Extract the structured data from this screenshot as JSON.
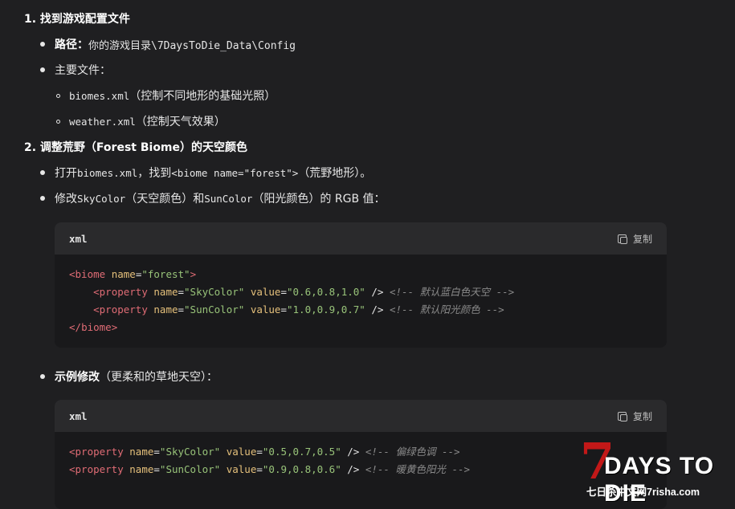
{
  "sec1": {
    "title": "1. 找到游戏配置文件"
  },
  "path": {
    "label": "路径：",
    "value": "你的游戏目录\\7DaysToDie_Data\\Config"
  },
  "main_files": {
    "label": "主要文件："
  },
  "file1": {
    "name": "biomes.xml",
    "desc": "（控制不同地形的基础光照）"
  },
  "file2": {
    "name": "weather.xml",
    "desc": "（控制天气效果）"
  },
  "sec2": {
    "title": "2. 调整荒野（Forest Biome）的天空颜色"
  },
  "step1": {
    "a": "打开 ",
    "file": "biomes.xml",
    "b": "，找到 ",
    "code": "<biome name=\"forest\">",
    "c": "（荒野地形）。"
  },
  "step2": {
    "a": "修改 ",
    "code1": "SkyColor",
    "b": "（天空颜色）和 ",
    "code2": "SunColor",
    "c": "（阳光颜色）的 RGB 值："
  },
  "code1": {
    "lang": "xml",
    "copy": "复制",
    "l1": {
      "open": "<",
      "tag": "biome",
      "sp": " ",
      "attr": "name",
      "eq": "=",
      "val": "\"forest\"",
      "close": ">"
    },
    "l2": {
      "ind": "    ",
      "open": "<",
      "tag": "property",
      "a1": "name",
      "v1": "\"SkyColor\"",
      "a2": "value",
      "v2": "\"0.6,0.8,1.0\"",
      "end": " />",
      "com": "<!-- 默认蓝白色天空 -->"
    },
    "l3": {
      "ind": "    ",
      "open": "<",
      "tag": "property",
      "a1": "name",
      "v1": "\"SunColor\"",
      "a2": "value",
      "v2": "\"1.0,0.9,0.7\"",
      "end": " />",
      "com": "<!-- 默认阳光颜色 -->"
    },
    "l4": {
      "open": "</",
      "tag": "biome",
      "close": ">"
    }
  },
  "example": {
    "label": "示例修改",
    "rest": "（更柔和的草地天空）："
  },
  "code2": {
    "lang": "xml",
    "copy": "复制",
    "l1": {
      "open": "<",
      "tag": "property",
      "a1": "name",
      "v1": "\"SkyColor\"",
      "a2": "value",
      "v2": "\"0.5,0.7,0.5\"",
      "end": " />",
      "com": "<!-- 偏绿色调 -->"
    },
    "l2": {
      "open": "<",
      "tag": "property",
      "a1": "name",
      "v1": "\"SunColor\"",
      "a2": "value",
      "v2": "\"0.9,0.8,0.6\"",
      "end": " />",
      "com": "<!-- 暖黄色阳光 -->"
    }
  },
  "logo": {
    "seven": "7",
    "text": "DAYS TO DIE",
    "sub": "七日杀中文网7risha.com"
  }
}
